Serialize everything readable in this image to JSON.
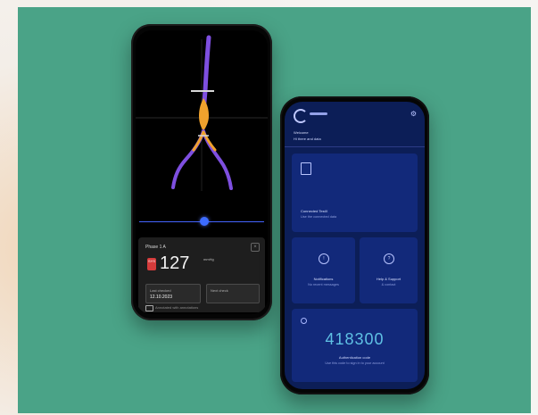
{
  "phone_left": {
    "card": {
      "title": "Phase 1 A",
      "close_icon": "close-icon",
      "badge": "SYS",
      "value": "127",
      "unit": "mmHg",
      "box1_label": "Last checked",
      "box1_value": "12.10.2023",
      "box2_label": "Next check",
      "box2_value": "",
      "footer": "Annotated with annotations"
    }
  },
  "phone_right": {
    "header": {
      "welcome": "Welcome",
      "name": "Hi there and data",
      "settings_icon": "gear-icon"
    },
    "tiles": {
      "main": {
        "title": "Connected TestX",
        "subtitle": "Use the connected data"
      },
      "left": {
        "title": "Notifications",
        "subtitle": "No recent messages"
      },
      "right": {
        "title": "Help & Support",
        "subtitle": "& contact"
      },
      "bottom": {
        "code": "418300",
        "title": "Authentication code",
        "subtitle": "Use this code to sign in to your account"
      }
    }
  }
}
